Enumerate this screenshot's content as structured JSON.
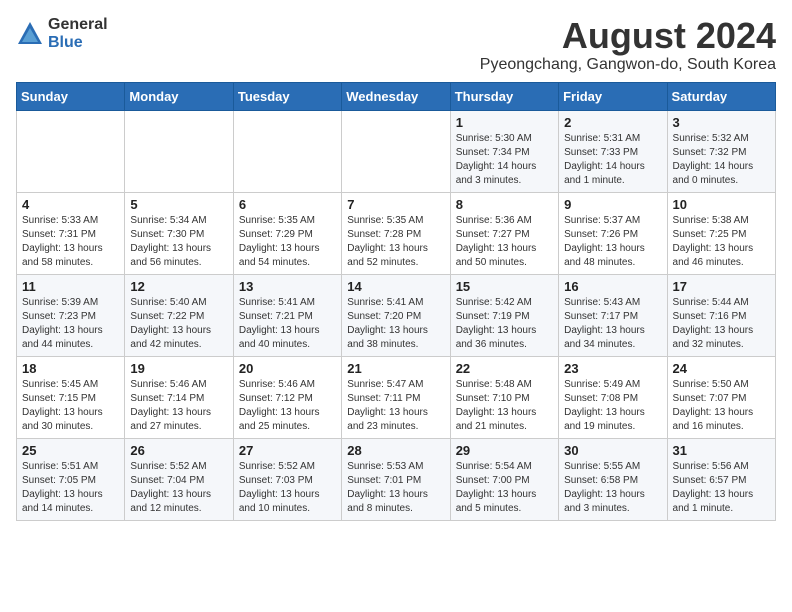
{
  "logo": {
    "general": "General",
    "blue": "Blue"
  },
  "title": "August 2024",
  "subtitle": "Pyeongchang, Gangwon-do, South Korea",
  "weekdays": [
    "Sunday",
    "Monday",
    "Tuesday",
    "Wednesday",
    "Thursday",
    "Friday",
    "Saturday"
  ],
  "weeks": [
    [
      {
        "day": "",
        "info": ""
      },
      {
        "day": "",
        "info": ""
      },
      {
        "day": "",
        "info": ""
      },
      {
        "day": "",
        "info": ""
      },
      {
        "day": "1",
        "info": "Sunrise: 5:30 AM\nSunset: 7:34 PM\nDaylight: 14 hours\nand 3 minutes."
      },
      {
        "day": "2",
        "info": "Sunrise: 5:31 AM\nSunset: 7:33 PM\nDaylight: 14 hours\nand 1 minute."
      },
      {
        "day": "3",
        "info": "Sunrise: 5:32 AM\nSunset: 7:32 PM\nDaylight: 14 hours\nand 0 minutes."
      }
    ],
    [
      {
        "day": "4",
        "info": "Sunrise: 5:33 AM\nSunset: 7:31 PM\nDaylight: 13 hours\nand 58 minutes."
      },
      {
        "day": "5",
        "info": "Sunrise: 5:34 AM\nSunset: 7:30 PM\nDaylight: 13 hours\nand 56 minutes."
      },
      {
        "day": "6",
        "info": "Sunrise: 5:35 AM\nSunset: 7:29 PM\nDaylight: 13 hours\nand 54 minutes."
      },
      {
        "day": "7",
        "info": "Sunrise: 5:35 AM\nSunset: 7:28 PM\nDaylight: 13 hours\nand 52 minutes."
      },
      {
        "day": "8",
        "info": "Sunrise: 5:36 AM\nSunset: 7:27 PM\nDaylight: 13 hours\nand 50 minutes."
      },
      {
        "day": "9",
        "info": "Sunrise: 5:37 AM\nSunset: 7:26 PM\nDaylight: 13 hours\nand 48 minutes."
      },
      {
        "day": "10",
        "info": "Sunrise: 5:38 AM\nSunset: 7:25 PM\nDaylight: 13 hours\nand 46 minutes."
      }
    ],
    [
      {
        "day": "11",
        "info": "Sunrise: 5:39 AM\nSunset: 7:23 PM\nDaylight: 13 hours\nand 44 minutes."
      },
      {
        "day": "12",
        "info": "Sunrise: 5:40 AM\nSunset: 7:22 PM\nDaylight: 13 hours\nand 42 minutes."
      },
      {
        "day": "13",
        "info": "Sunrise: 5:41 AM\nSunset: 7:21 PM\nDaylight: 13 hours\nand 40 minutes."
      },
      {
        "day": "14",
        "info": "Sunrise: 5:41 AM\nSunset: 7:20 PM\nDaylight: 13 hours\nand 38 minutes."
      },
      {
        "day": "15",
        "info": "Sunrise: 5:42 AM\nSunset: 7:19 PM\nDaylight: 13 hours\nand 36 minutes."
      },
      {
        "day": "16",
        "info": "Sunrise: 5:43 AM\nSunset: 7:17 PM\nDaylight: 13 hours\nand 34 minutes."
      },
      {
        "day": "17",
        "info": "Sunrise: 5:44 AM\nSunset: 7:16 PM\nDaylight: 13 hours\nand 32 minutes."
      }
    ],
    [
      {
        "day": "18",
        "info": "Sunrise: 5:45 AM\nSunset: 7:15 PM\nDaylight: 13 hours\nand 30 minutes."
      },
      {
        "day": "19",
        "info": "Sunrise: 5:46 AM\nSunset: 7:14 PM\nDaylight: 13 hours\nand 27 minutes."
      },
      {
        "day": "20",
        "info": "Sunrise: 5:46 AM\nSunset: 7:12 PM\nDaylight: 13 hours\nand 25 minutes."
      },
      {
        "day": "21",
        "info": "Sunrise: 5:47 AM\nSunset: 7:11 PM\nDaylight: 13 hours\nand 23 minutes."
      },
      {
        "day": "22",
        "info": "Sunrise: 5:48 AM\nSunset: 7:10 PM\nDaylight: 13 hours\nand 21 minutes."
      },
      {
        "day": "23",
        "info": "Sunrise: 5:49 AM\nSunset: 7:08 PM\nDaylight: 13 hours\nand 19 minutes."
      },
      {
        "day": "24",
        "info": "Sunrise: 5:50 AM\nSunset: 7:07 PM\nDaylight: 13 hours\nand 16 minutes."
      }
    ],
    [
      {
        "day": "25",
        "info": "Sunrise: 5:51 AM\nSunset: 7:05 PM\nDaylight: 13 hours\nand 14 minutes."
      },
      {
        "day": "26",
        "info": "Sunrise: 5:52 AM\nSunset: 7:04 PM\nDaylight: 13 hours\nand 12 minutes."
      },
      {
        "day": "27",
        "info": "Sunrise: 5:52 AM\nSunset: 7:03 PM\nDaylight: 13 hours\nand 10 minutes."
      },
      {
        "day": "28",
        "info": "Sunrise: 5:53 AM\nSunset: 7:01 PM\nDaylight: 13 hours\nand 8 minutes."
      },
      {
        "day": "29",
        "info": "Sunrise: 5:54 AM\nSunset: 7:00 PM\nDaylight: 13 hours\nand 5 minutes."
      },
      {
        "day": "30",
        "info": "Sunrise: 5:55 AM\nSunset: 6:58 PM\nDaylight: 13 hours\nand 3 minutes."
      },
      {
        "day": "31",
        "info": "Sunrise: 5:56 AM\nSunset: 6:57 PM\nDaylight: 13 hours\nand 1 minute."
      }
    ]
  ]
}
